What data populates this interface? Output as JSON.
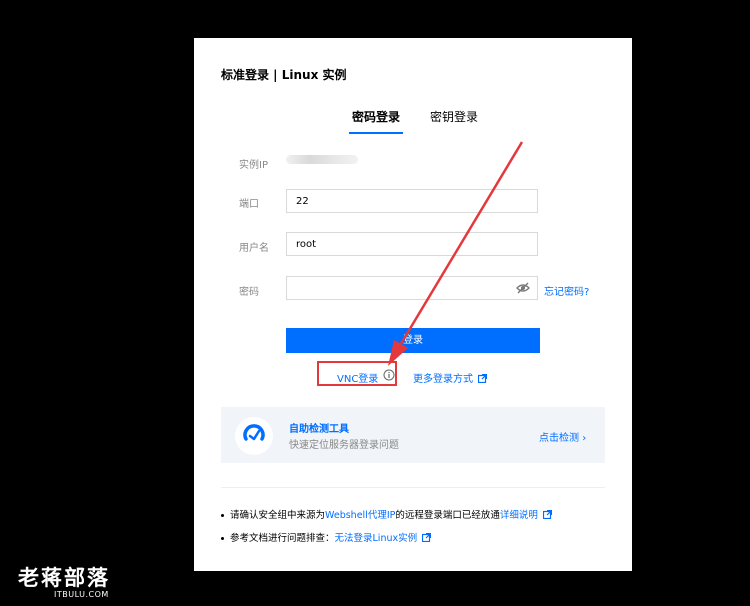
{
  "dialog": {
    "title": "标准登录 | Linux 实例",
    "tabs": [
      {
        "label": "密码登录",
        "active": true
      },
      {
        "label": "密钥登录",
        "active": false
      }
    ],
    "fields": {
      "ip_label": "实例IP",
      "port_label": "端口",
      "port_value": "22",
      "username_label": "用户名",
      "username_value": "root",
      "password_label": "密码",
      "password_value": ""
    },
    "forgot_password": "忘记密码?",
    "login_button": "登录",
    "vnc_login": "VNC登录",
    "more_login": "更多登录方式",
    "detect": {
      "title": "自助检测工具",
      "subtitle": "快速定位服务器登录问题",
      "link": "点击检测"
    },
    "notes": {
      "note1_pre": "请确认安全组中来源为",
      "note1_link1": "Webshell代理IP",
      "note1_mid": "的远程登录端口已经放通",
      "note1_link2": "详细说明",
      "note2_pre": "参考文档进行问题排查：",
      "note2_link": "无法登录Linux实例"
    }
  },
  "watermark": {
    "main": "老蒋部落",
    "sub": "ITBULU.COM"
  },
  "colors": {
    "accent": "#006eff",
    "annotation": "#e4393c",
    "background": "#000000",
    "card": "#f1f4f9"
  }
}
